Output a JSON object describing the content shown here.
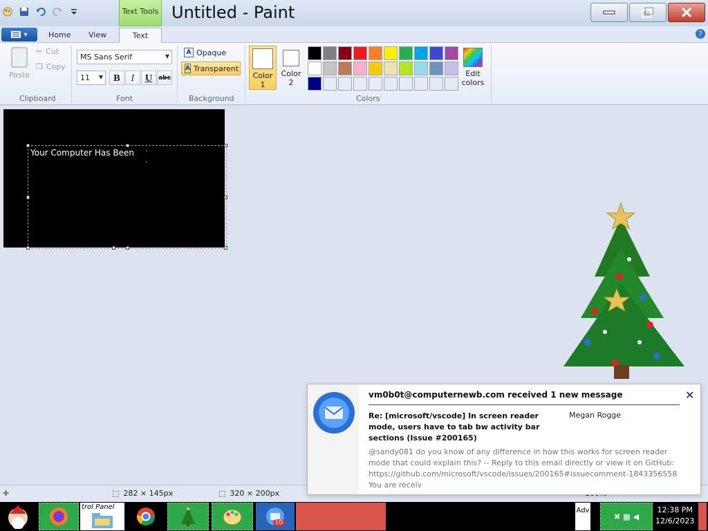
{
  "window": {
    "title": "Untitled - Paint",
    "contextual_tab_label": "Text Tools"
  },
  "ribbon_tabs": {
    "app_menu": "",
    "home": "Home",
    "view": "View",
    "text": "Text"
  },
  "clipboard": {
    "paste": "Paste",
    "cut": "Cut",
    "copy": "Copy",
    "group": "Clipboard"
  },
  "font": {
    "family": "MS Sans Serif",
    "size": "11",
    "bold": "B",
    "italic": "I",
    "underline": "U",
    "strike": "abc",
    "group": "Font"
  },
  "background": {
    "opaque": "Opaque",
    "transparent": "Transparent",
    "group": "Background",
    "selected": "Transparent"
  },
  "colors": {
    "color1_label": "Color\n1",
    "color1_line1": "Color",
    "color1_line2": "1",
    "color2_line1": "Color",
    "color2_line2": "2",
    "edit_line1": "Edit",
    "edit_line2": "colors",
    "group": "Colors",
    "color1_value": "#ffffff",
    "color2_value": "#ffffff",
    "palette": [
      "#000000",
      "#7f7f7f",
      "#880015",
      "#ed1c24",
      "#ff7f27",
      "#fff200",
      "#22b14c",
      "#00a2e8",
      "#3f48cc",
      "#a349a4",
      "#ffffff",
      "#c3c3c3",
      "#b97a57",
      "#ffaec9",
      "#ffc90e",
      "#efe4b0",
      "#b5e61d",
      "#99d9ea",
      "#7092be",
      "#c8bfe7",
      "#000080",
      "#e6ecf3",
      "#e6ecf3",
      "#e6ecf3",
      "#e6ecf3",
      "#e6ecf3",
      "#e6ecf3",
      "#e6ecf3",
      "#e6ecf3",
      "#e6ecf3"
    ]
  },
  "canvas": {
    "background": "#000000",
    "text": "Your Computer Has Been"
  },
  "status": {
    "selection_size": "282 × 145px",
    "image_size": "320 × 200px",
    "zoom": "100%"
  },
  "notification": {
    "title": "vm0b0t@computernewb.com received 1 new message",
    "subject": "Re: [microsoft/vscode] In screen reader mode, users have to tab bw activity bar sections (Issue #200165)",
    "sender": "Megan Rogge",
    "body": "@sandy081 do you know of any difference in how this works for screen reader mode that could explain this? -- Reply to this email directly or view it on GitHub: https://github.com/microsoft/vscode/issues/200165#issuecomment-1843356558 You are receiv"
  },
  "taskbar": {
    "explorer_label": "trol Panel",
    "thunderbird_badge": "10",
    "tray_text": "Adv",
    "time": "12:38 PM",
    "date": "12/6/2023"
  }
}
